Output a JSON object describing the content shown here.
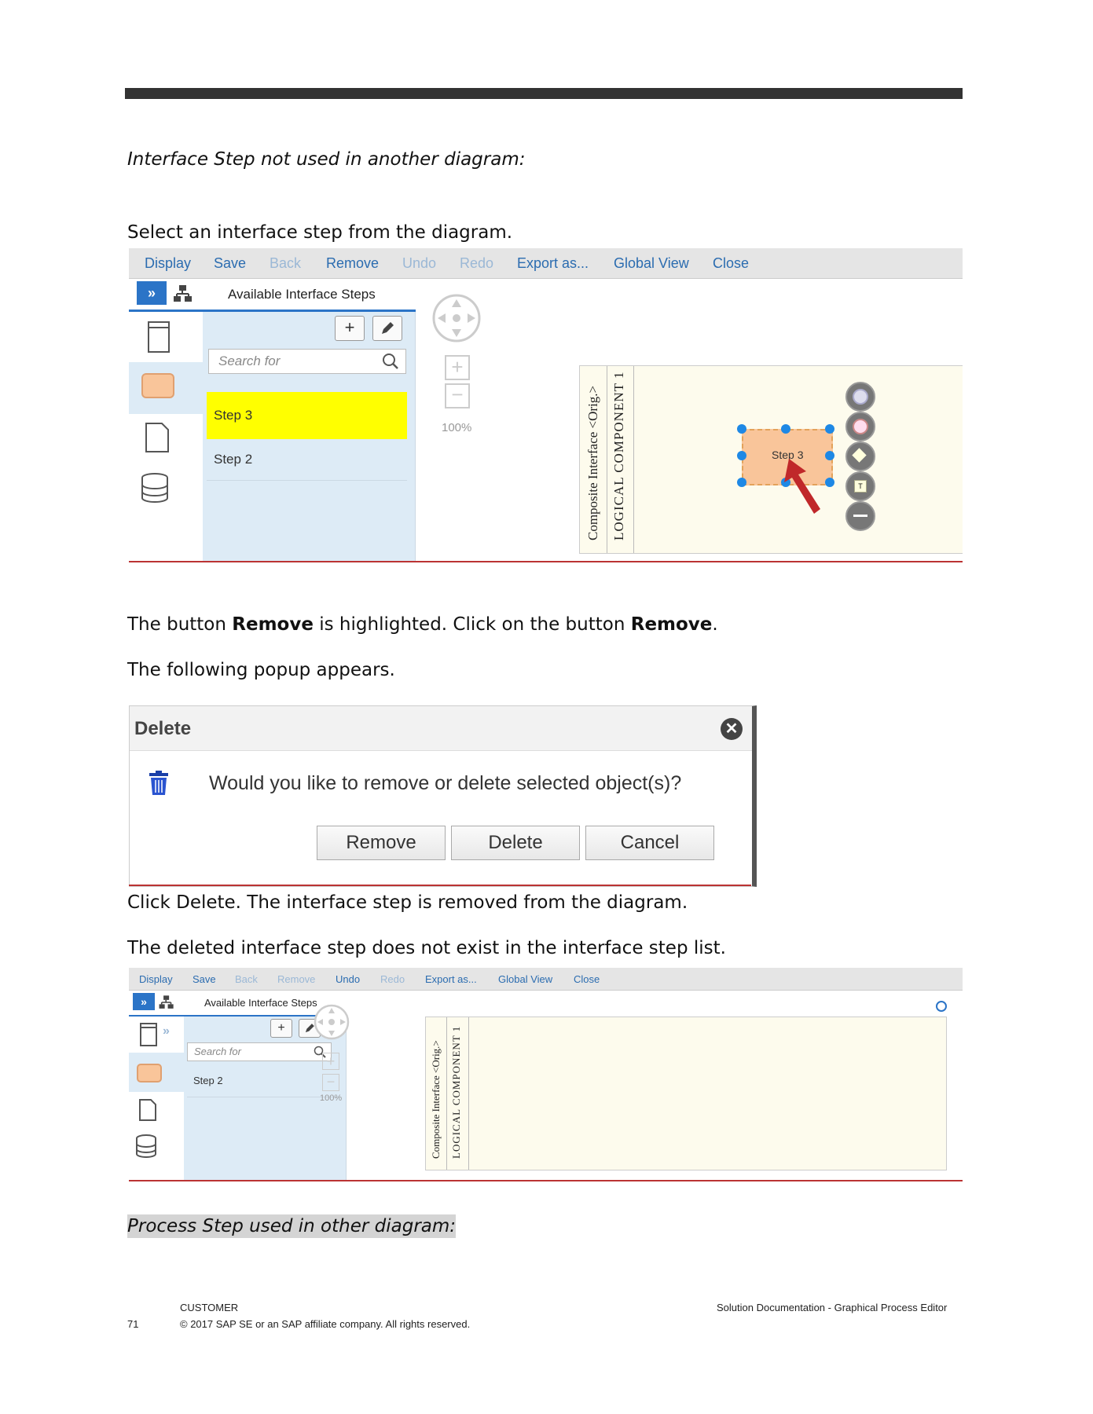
{
  "heading1": "Interface Step not used in another diagram:",
  "para_select": "Select an interface step from the diagram.",
  "para_button": {
    "p1": "The button ",
    "b1": "Remove",
    "p2": " is highlighted. Click on the button ",
    "b2": "Remove",
    "p3": "."
  },
  "para_popup": "The following popup appears.",
  "para_click_delete": "Click Delete. The interface step is removed from the diagram.",
  "para_deleted": "The deleted interface step does not exist in the interface step list.",
  "heading2": "Process Step used in other diagram:",
  "toolbar": {
    "display": "Display",
    "save": "Save",
    "back": "Back",
    "remove": "Remove",
    "undo": "Undo",
    "redo": "Redo",
    "export": "Export as...",
    "global_view": "Global View",
    "close": "Close"
  },
  "panel": {
    "title": "Available Interface Steps",
    "search_placeholder": "Search for",
    "zoom": "100%"
  },
  "shot1": {
    "items": [
      "Step 3",
      "Step 2"
    ],
    "selected_item": "Step 3",
    "node_label": "Step 3"
  },
  "shot2": {
    "items": [
      "Step 2"
    ]
  },
  "lane": {
    "label1": "Composite Interface <Orig.>",
    "label2": "LOGICAL COMPONENT 1"
  },
  "dialog": {
    "title": "Delete",
    "message": "Would you like to remove or delete selected object(s)?",
    "remove": "Remove",
    "delete": "Delete",
    "cancel": "Cancel"
  },
  "footer": {
    "page_number": "71",
    "classification": "CUSTOMER",
    "copyright": "© 2017 SAP SE or an SAP affiliate company. All rights reserved.",
    "doc_title": "Solution Documentation - Graphical Process Editor"
  },
  "colors": {
    "link_blue": "#2b6cb0",
    "highlight_yellow": "#ffff00",
    "panel_blue": "#ddebf6",
    "node_orange": "#f9c59a",
    "handle_blue": "#1e88e5",
    "divider_red": "#b33333"
  }
}
